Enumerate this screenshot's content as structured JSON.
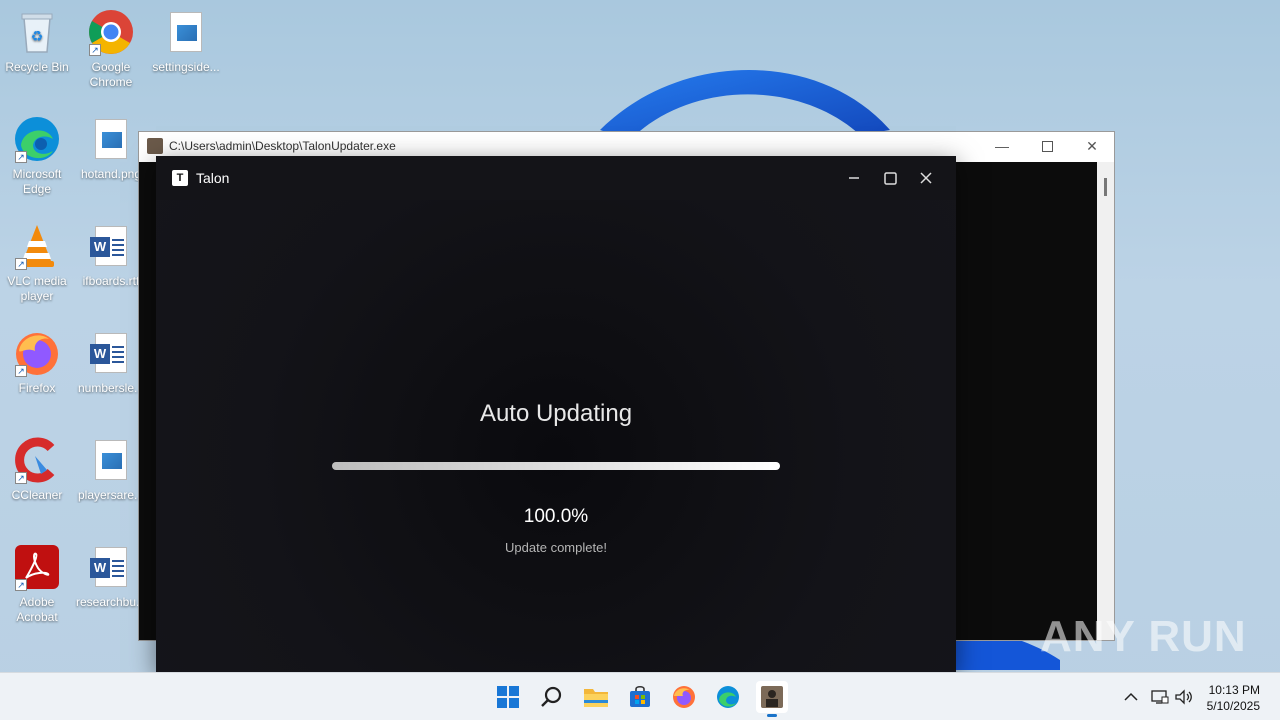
{
  "desktop": {
    "icons": [
      {
        "label": "Recycle Bin"
      },
      {
        "label": "Google Chrome"
      },
      {
        "label": "settingside..."
      },
      {
        "label": "Microsoft Edge"
      },
      {
        "label": "hotand.png"
      },
      {
        "label": "VLC media player"
      },
      {
        "label": "ifboards.rtf"
      },
      {
        "label": "Firefox"
      },
      {
        "label": "numbersle..."
      },
      {
        "label": "CCleaner"
      },
      {
        "label": "playersare..."
      },
      {
        "label": "Adobe Acrobat"
      },
      {
        "label": "researchbu..."
      }
    ]
  },
  "console": {
    "title": "C:\\Users\\admin\\Desktop\\TalonUpdater.exe"
  },
  "talon": {
    "title": "Talon",
    "logo_letter": "T",
    "heading": "Auto Updating",
    "progress": 1.0,
    "percent_text": "100.0%",
    "status_text": "Update complete!"
  },
  "watermark": {
    "text": "ANY RUN"
  },
  "taskbar": {
    "apps": [
      "start-icon",
      "search-icon",
      "file-explorer-icon",
      "store-icon",
      "firefox-icon",
      "edge-icon",
      "talon-updater-icon"
    ],
    "time": "10:13 PM",
    "date": "5/10/2025"
  }
}
